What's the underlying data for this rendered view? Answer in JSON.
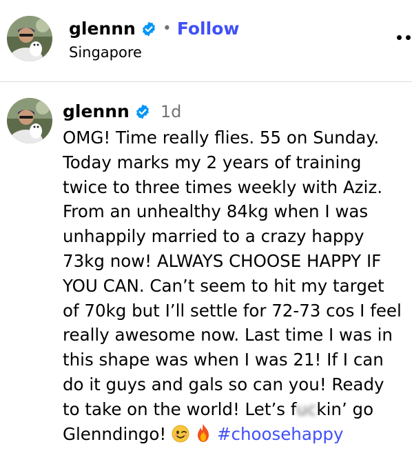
{
  "header": {
    "username": "glennn",
    "separator": "•",
    "follow_label": "Follow",
    "location": "Singapore",
    "verified_icon": "verified-badge-icon",
    "more_icon": "more-options-icon"
  },
  "post": {
    "username": "glennn",
    "timestamp": "1d",
    "caption_lines": [
      "OMG! Time really flies. 55 on Sunday.",
      "Today marks my 2 years of training",
      "twice to three times weekly with Aziz.",
      "From an unhealthy 84kg when I was",
      "unhappily married to a crazy happy",
      "73kg now! ALWAYS CHOOSE HAPPY IF",
      "YOU CAN. Can’t seem to hit my target",
      "of 70kg but I’ll settle for 72-73 cos I feel",
      "really awesome now. Last time I was in",
      "this shape was when I was 21! If I can",
      "do it guys and gals so can you! Ready"
    ],
    "line12_before": "to take on the world! Let’s f",
    "line12_redacted": "uc",
    "line12_after": "kin’ go",
    "line13_text": "Glenndingo! ",
    "emojis": [
      "winking-face-emoji",
      "fire-emoji"
    ],
    "hashtag": "#choosehappy"
  },
  "colors": {
    "accent": "#4150f7",
    "verified": "#0095f6",
    "muted": "#737373",
    "divider": "#dbdbdb"
  }
}
